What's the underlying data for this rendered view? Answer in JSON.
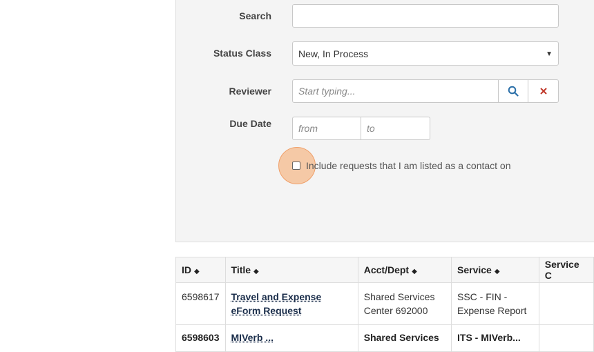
{
  "filters": {
    "search": {
      "label": "Search",
      "value": ""
    },
    "status_class": {
      "label": "Status Class",
      "value": "New, In Process"
    },
    "reviewer": {
      "label": "Reviewer",
      "placeholder": "Start typing..."
    },
    "due_date": {
      "label": "Due Date",
      "from_placeholder": "from",
      "to_placeholder": "to"
    },
    "contact_checkbox": {
      "label": "Include requests that I am listed as a contact on",
      "checked": false
    }
  },
  "table": {
    "headers": [
      "ID",
      "Title",
      "Acct/Dept",
      "Service",
      "Service C"
    ],
    "rows": [
      {
        "id": "6598617",
        "title": "Travel and Expense eForm Request",
        "acct": "Shared Services Center 692000",
        "service": "SSC - FIN - Expense Report"
      },
      {
        "id": "6598603",
        "title": "MIVerb ...",
        "acct": "Shared Services",
        "service": "ITS - MIVerb..."
      }
    ]
  },
  "colors": {
    "accent_highlight": "#f5a666",
    "link": "#1a2d4a",
    "clear": "#c0392b",
    "search_icon": "#2a6fa8"
  }
}
